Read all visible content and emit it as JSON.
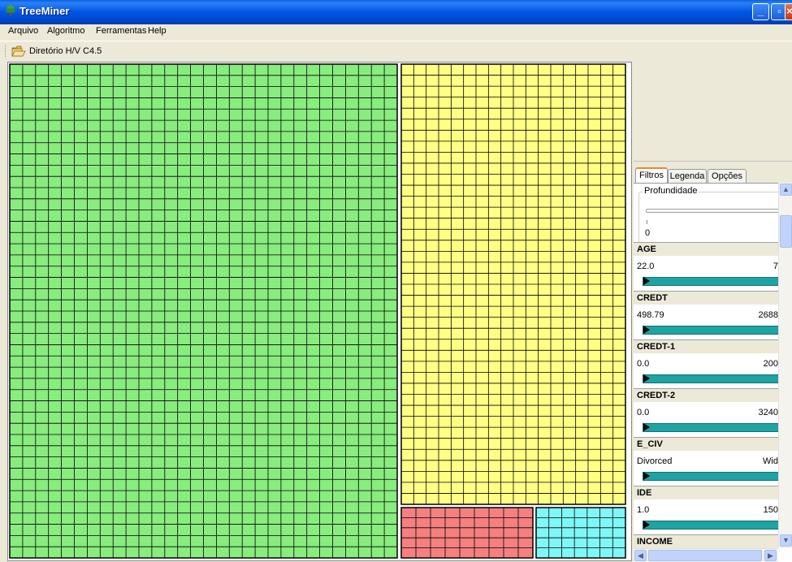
{
  "window": {
    "title": "TreeMiner",
    "app_icon": "tree-icon"
  },
  "menu": [
    "Arquivo",
    "Algoritmo",
    "Ferramentas",
    "Help"
  ],
  "toolbar": {
    "folder_icon": "folder-open-icon",
    "label": "Diretório  H/V  C4.5"
  },
  "treemap": {
    "colors": {
      "green": "#88ec7e",
      "yellow": "#ffff86",
      "red": "#f58080",
      "cyan": "#7ff7f7"
    }
  },
  "tabs": [
    "Filtros",
    "Legenda",
    "Opções"
  ],
  "depth": {
    "title": "Profundidade",
    "value": "0"
  },
  "filters": [
    {
      "name": "AGE",
      "min": "22.0",
      "max": "7"
    },
    {
      "name": "CREDT",
      "min": "498.79",
      "max": "2688"
    },
    {
      "name": "CREDT-1",
      "min": "0.0",
      "max": "200"
    },
    {
      "name": "CREDT-2",
      "min": "0.0",
      "max": "3240"
    },
    {
      "name": "E_CIV",
      "min": "Divorced",
      "max": "Wid"
    },
    {
      "name": "IDE",
      "min": "1.0",
      "max": "150"
    },
    {
      "name": "INCOME",
      "min": "",
      "max": ""
    }
  ],
  "accent_color": "#1fa3a3"
}
